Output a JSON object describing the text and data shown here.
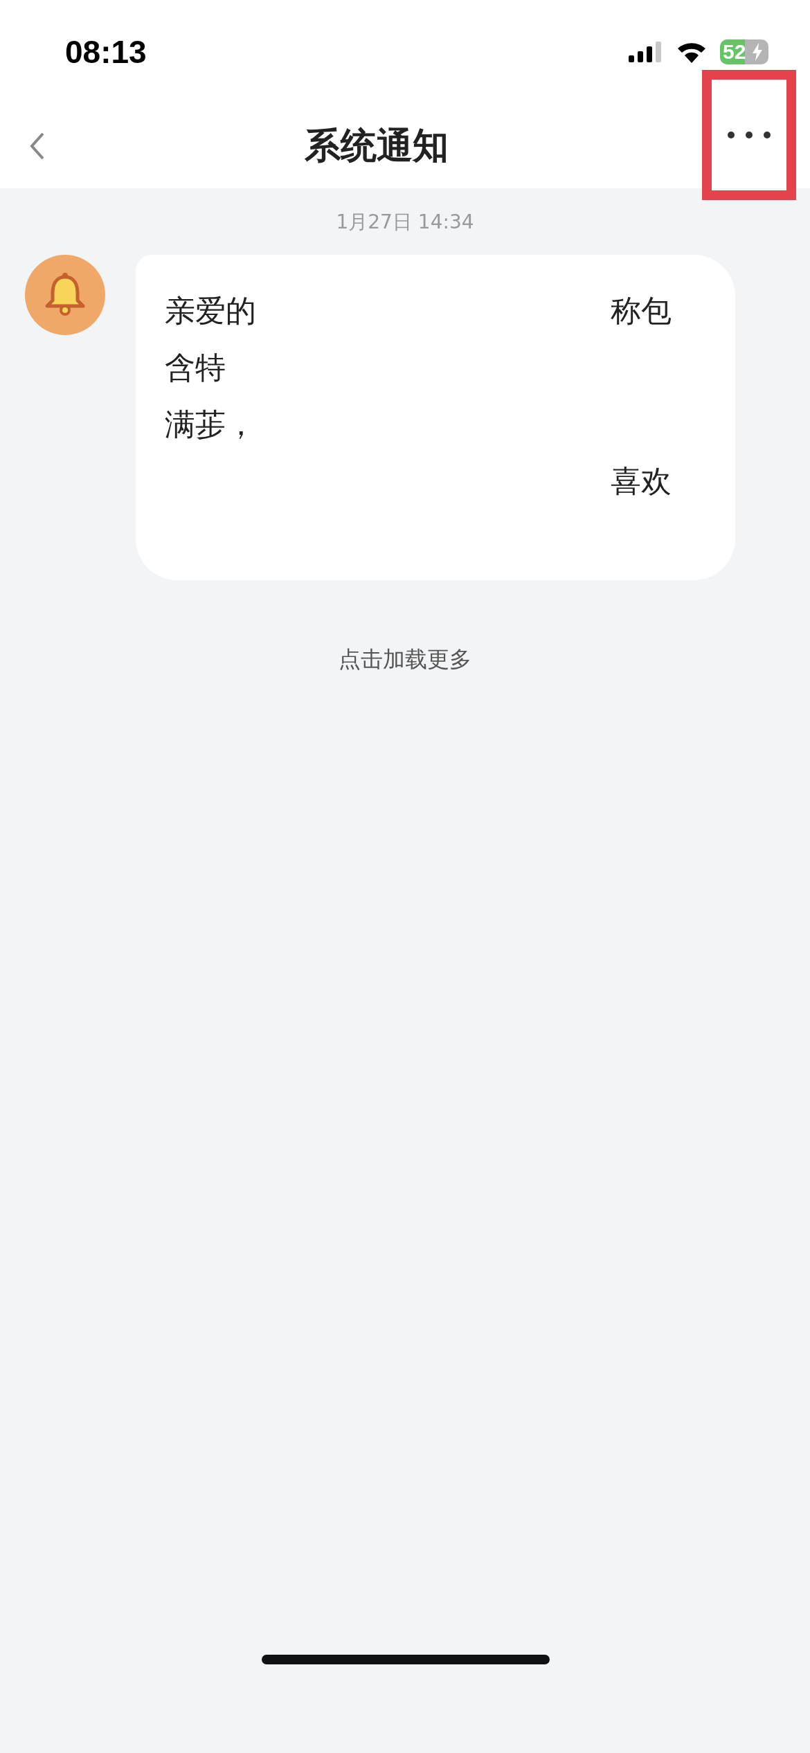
{
  "status_bar": {
    "time": "08:13",
    "battery": "52"
  },
  "nav": {
    "title": "系统通知",
    "highlight_more": true
  },
  "messages": [
    {
      "timestamp": "1月27日 14:34",
      "lines": [
        {
          "left": "亲爱的",
          "right": "称包"
        },
        {
          "left": "含特"
        },
        {
          "left": "满荹，"
        },
        {
          "right": "喜欢"
        }
      ]
    }
  ],
  "load_more": "点击加载更多"
}
